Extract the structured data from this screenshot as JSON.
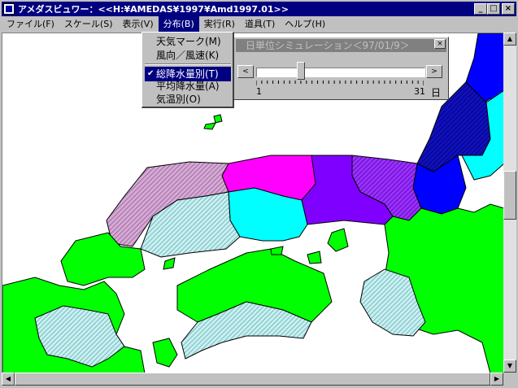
{
  "window": {
    "title": "アメダスビュワー：<<H:¥AMEDAS¥1997¥Amd1997.01>>",
    "buttons": {
      "minimize": "_",
      "maximize": "□",
      "close": "×"
    }
  },
  "menubar": {
    "items": [
      {
        "label": "ファイル(F)",
        "active": false
      },
      {
        "label": "スケール(S)",
        "active": false
      },
      {
        "label": "表示(V)",
        "active": false
      },
      {
        "label": "分布(B)",
        "active": true
      },
      {
        "label": "実行(R)",
        "active": false
      },
      {
        "label": "道具(T)",
        "active": false
      },
      {
        "label": "ヘルプ(H)",
        "active": false
      }
    ]
  },
  "dropdown": {
    "items": [
      {
        "label": "天気マーク(M)",
        "checked": false,
        "selected": false
      },
      {
        "label": "風向／風速(K)",
        "checked": false,
        "selected": false
      },
      {
        "label": "総降水量別(T)",
        "checked": true,
        "selected": true
      },
      {
        "label": "平均降水量(A)",
        "checked": false,
        "selected": false
      },
      {
        "label": "気温別(O)",
        "checked": false,
        "selected": false
      }
    ],
    "check_glyph": "✔"
  },
  "simulation": {
    "title": "日単位シミュレーション＜97/01/9＞",
    "close": "×",
    "left_arrow": "<",
    "right_arrow": ">",
    "min_label": "1",
    "max_label": "31",
    "unit_label": "日",
    "day": 9,
    "day_min": 1,
    "day_max": 31
  },
  "colors": {
    "green": "#00ff00",
    "cyan": "#00ffff",
    "magenta": "#ff00ff",
    "purple": "#8000ff",
    "blue": "#0000ff",
    "navy": "#0000a0",
    "mauve": "#c080c0",
    "pale_cyan": "#a0e0e0",
    "titlebar": "#000080"
  }
}
